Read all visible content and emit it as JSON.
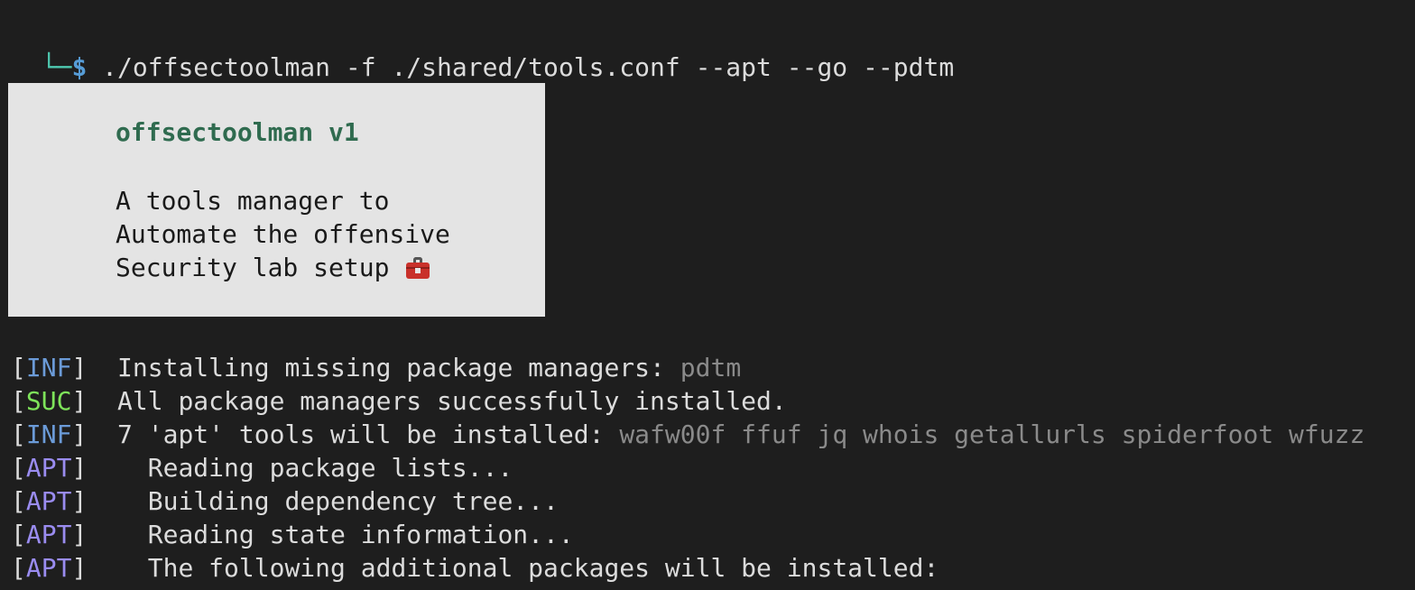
{
  "prompt": {
    "corner": "└─",
    "dollar": "$",
    "command": " ./offsectoolman -f ./shared/tools.conf --apt --go --pdtm"
  },
  "banner": {
    "title": "offsectoolman v1",
    "lines": [
      "A tools manager to",
      "Automate the offensive",
      "Security lab setup"
    ],
    "icon": "toolbox-icon"
  },
  "log": [
    {
      "tag": "INF",
      "message": "Installing missing package managers: ",
      "highlight": "pdtm"
    },
    {
      "tag": "SUC",
      "message": "All package managers successfully installed.",
      "highlight": ""
    },
    {
      "tag": "INF",
      "message": "7 'apt' tools will be installed: ",
      "highlight": "wafw00f ffuf jq whois getallurls spiderfoot wfuzz"
    },
    {
      "tag": "APT",
      "message": "  Reading package lists...",
      "highlight": ""
    },
    {
      "tag": "APT",
      "message": "  Building dependency tree...",
      "highlight": ""
    },
    {
      "tag": "APT",
      "message": "  Reading state information...",
      "highlight": ""
    },
    {
      "tag": "APT",
      "message": "  The following additional packages will be installed:",
      "highlight": ""
    }
  ],
  "colors": {
    "background": "#1e1e1e",
    "inf": "#6b9bd8",
    "suc": "#7ee35a",
    "apt": "#9a8cf0",
    "banner_bg": "#e4e4e4",
    "banner_title": "#2f6b4f"
  }
}
